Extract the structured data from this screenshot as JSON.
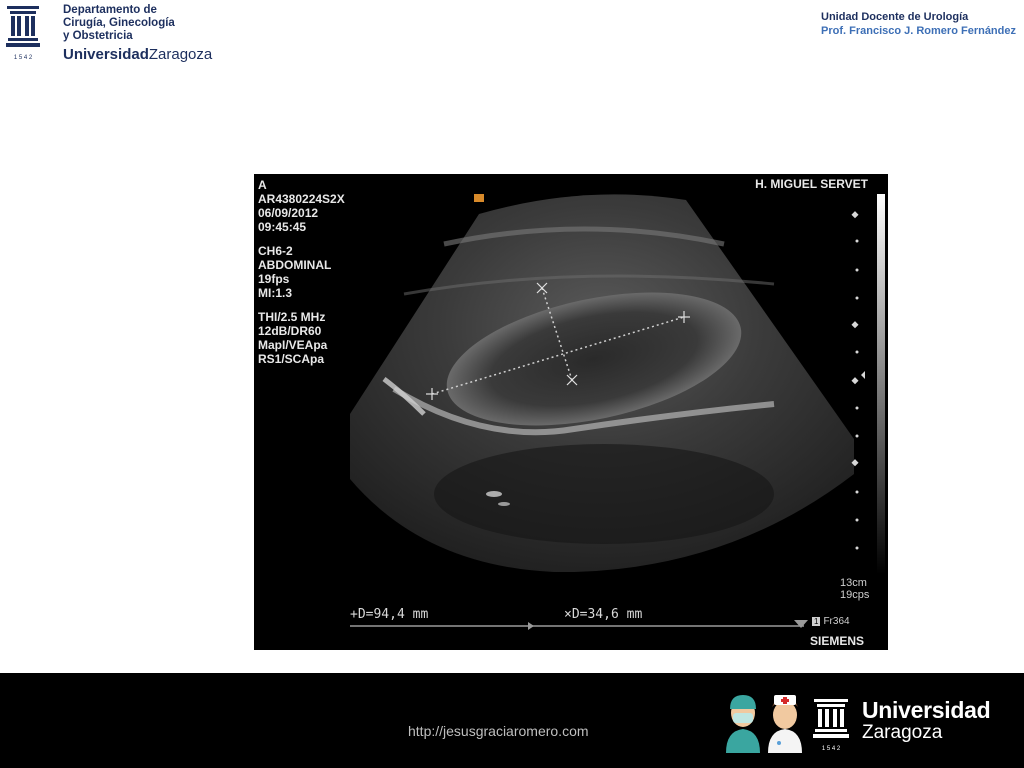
{
  "header": {
    "dept_lines": [
      "Departamento de",
      "Cirugía, Ginecología",
      "y Obstetricia"
    ],
    "dept_univ_bold": "Universidad",
    "dept_univ_rest": "Zaragoza",
    "crest_year": "1 5 4 2",
    "unidad_title": "Unidad Docente de Urología",
    "unidad_prof": "Prof. Francisco J.  Romero Fernández"
  },
  "ultrasound": {
    "info_patient": "A",
    "info_id": "AR4380224S2X",
    "info_date": "06/09/2012",
    "info_time": "09:45:45",
    "probe": "CH6-2",
    "preset": "ABDOMINAL",
    "fps": "19fps",
    "mi": "MI:1.3",
    "thi": "THI/2.5 MHz",
    "gain": "12dB/DR60",
    "map": "MapI/VEApa",
    "rs": "RS1/SCApa",
    "hospital": "H. MIGUEL SERVET",
    "depth": "13cm",
    "cps": "19cps",
    "measure_1": "+D=94,4 mm",
    "measure_2": "×D=34,6 mm",
    "frame": "Fr364",
    "frame_box": "1",
    "brand": "SIEMENS"
  },
  "footer": {
    "url": "http://jesusgraciaromero.com",
    "univ_line1": "Universidad",
    "univ_line2": "Zaragoza",
    "crest_year": "1 5 4 2"
  },
  "colors": {
    "navy": "#1d2f5e",
    "prof_blue": "#3d6fb6",
    "footer_bg": "#000000"
  }
}
